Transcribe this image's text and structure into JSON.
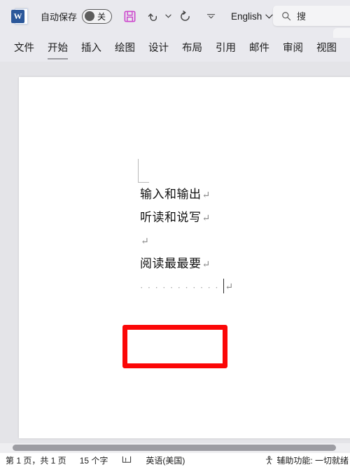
{
  "titlebar": {
    "app_logo_letter": "W",
    "autosave_label": "自动保存",
    "autosave_state": "关",
    "save_icon": "save-floppy-icon",
    "undo_icon": "undo-arrow-icon",
    "redo_icon": "redo-arrow-icon",
    "more_icon": "customize-quick-access-icon",
    "language": "English",
    "language_caret": "⌄"
  },
  "search": {
    "icon": "search-magnifier-icon",
    "placeholder": "搜"
  },
  "ribbon": {
    "tabs": [
      {
        "label": "文件",
        "active": false
      },
      {
        "label": "开始",
        "active": true
      },
      {
        "label": "插入",
        "active": false
      },
      {
        "label": "绘图",
        "active": false
      },
      {
        "label": "设计",
        "active": false
      },
      {
        "label": "布局",
        "active": false
      },
      {
        "label": "引用",
        "active": false
      },
      {
        "label": "邮件",
        "active": false
      },
      {
        "label": "审阅",
        "active": false
      },
      {
        "label": "视图",
        "active": false
      }
    ]
  },
  "document": {
    "paragraphs": [
      {
        "text": "输入和输出",
        "mark": "↵"
      },
      {
        "text": "听读和说写",
        "mark": "↵"
      },
      {
        "text": "",
        "mark": "↵"
      },
      {
        "text": "阅读最最要",
        "mark": "↵"
      }
    ],
    "space_line": {
      "dots": "···········",
      "dot_count": 11,
      "mark": "↵",
      "caret_visible": true
    }
  },
  "annotation": {
    "shape": "rectangle",
    "color": "#fb0707",
    "target": "space-dots-line"
  },
  "statusbar": {
    "pages": "第 1 页，共 1 页",
    "words": "15 个字",
    "proofing_icon": "proofing-errors-icon",
    "language": "英语(美国)",
    "accessibility_icon": "accessibility-person-icon",
    "accessibility": "辅助功能: 一切就绪"
  },
  "colors": {
    "word_blue": "#2b579a",
    "save_magenta": "#cc44cc",
    "annotation_red": "#fb0707",
    "chrome_gray": "#e9e9ee"
  }
}
